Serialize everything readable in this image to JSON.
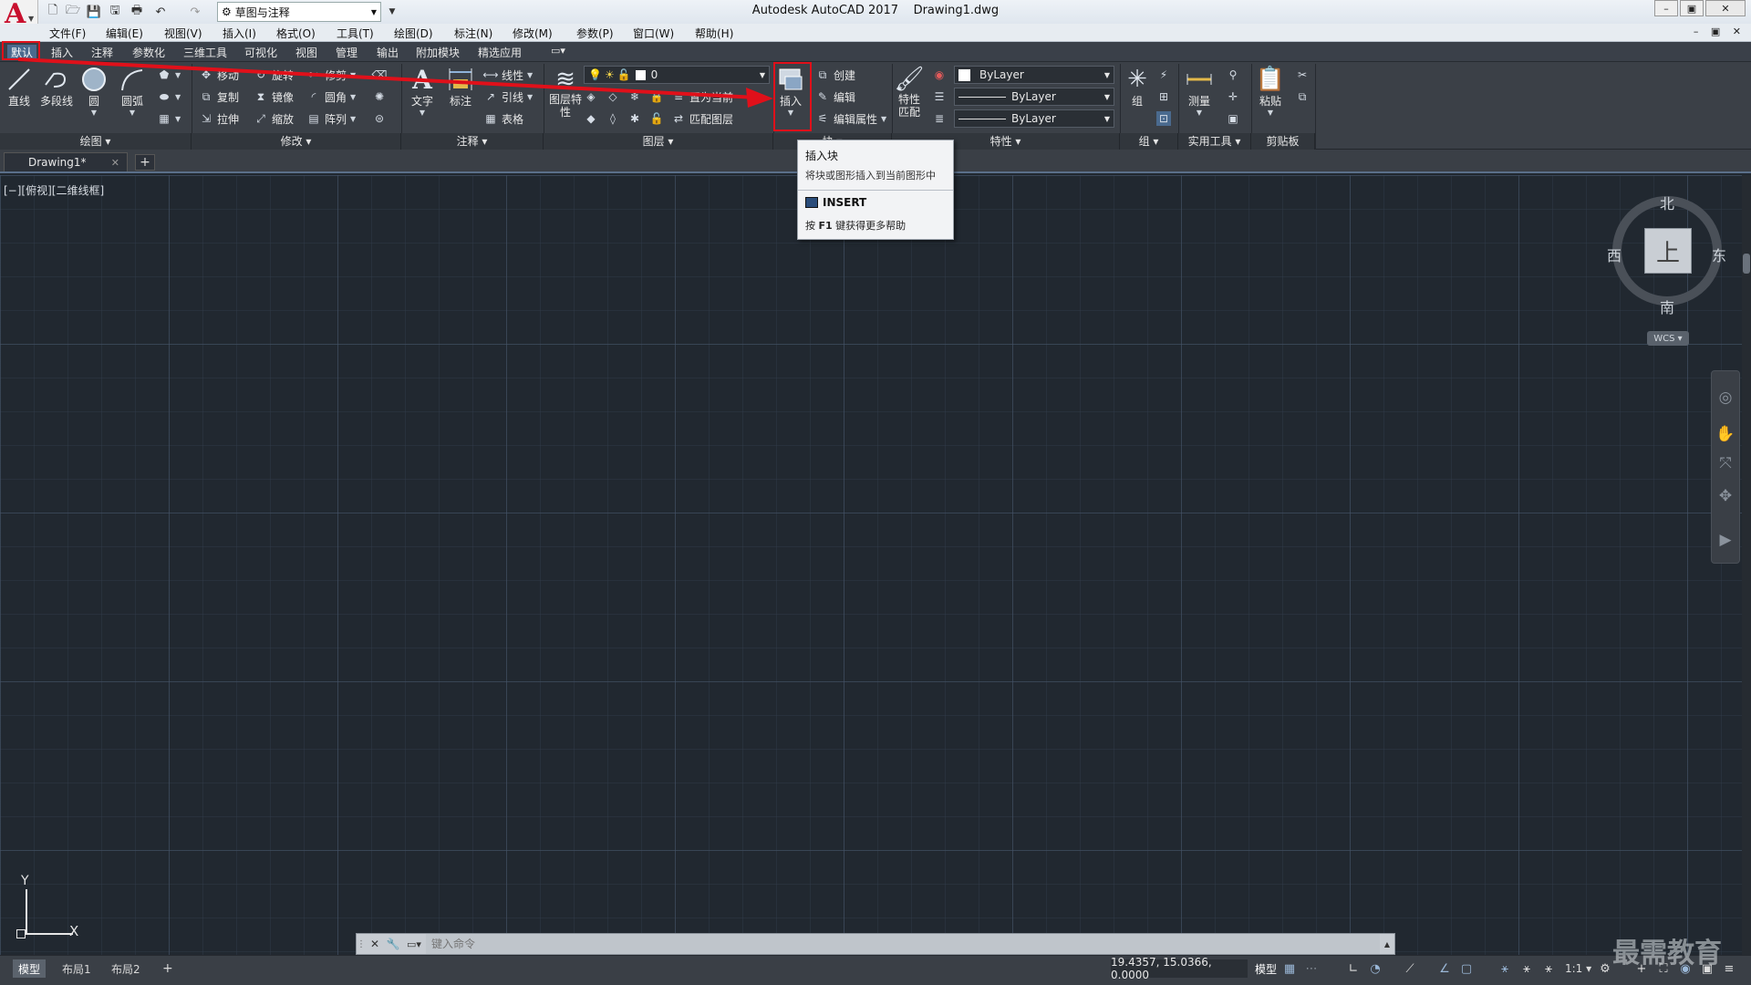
{
  "titlebar": {
    "app_title": "Autodesk AutoCAD 2017",
    "doc_title": "Drawing1.dwg",
    "workspace": "草图与注释",
    "win_min": "–",
    "win_restore": "▣",
    "win_close": "✕"
  },
  "menubar": {
    "items": [
      "文件(F)",
      "编辑(E)",
      "视图(V)",
      "插入(I)",
      "格式(O)",
      "工具(T)",
      "绘图(D)",
      "标注(N)",
      "修改(M)",
      "参数(P)",
      "窗口(W)",
      "帮助(H)"
    ],
    "mdi_controls": "– ▣ ✕"
  },
  "ribbon_tabs": [
    "默认",
    "插入",
    "注释",
    "参数化",
    "三维工具",
    "可视化",
    "视图",
    "管理",
    "输出",
    "附加模块",
    "精选应用"
  ],
  "ribbon": {
    "draw": {
      "title": "绘图",
      "line": "直线",
      "polyline": "多段线",
      "circle": "圆",
      "arc": "圆弧"
    },
    "modify": {
      "title": "修改",
      "move": "移动",
      "rotate": "旋转",
      "trim": "修剪",
      "copy": "复制",
      "mirror": "镜像",
      "fillet": "圆角",
      "stretch": "拉伸",
      "scale": "缩放",
      "array": "阵列"
    },
    "annotation": {
      "title": "注释",
      "text": "文字",
      "dimension": "标注",
      "linear": "线性",
      "leader": "引线",
      "table": "表格"
    },
    "layers": {
      "title": "图层",
      "layer_props": "图层特性",
      "current_layer": "0",
      "make_current": "置为当前",
      "match_layer": "匹配图层"
    },
    "block": {
      "title": "块",
      "insert": "插入",
      "create": "创建",
      "edit": "编辑",
      "edit_attr": "编辑属性"
    },
    "properties": {
      "title": "特性",
      "match": "特性匹配",
      "color": "ByLayer",
      "linetype": "ByLayer",
      "lineweight": "ByLayer"
    },
    "groups": {
      "title": "组",
      "group": "组"
    },
    "utilities": {
      "title": "实用工具",
      "measure": "测量"
    },
    "clipboard": {
      "title": "剪贴板",
      "paste": "粘贴"
    }
  },
  "doc_tabs": {
    "active": "Drawing1*",
    "close": "✕",
    "new": "+"
  },
  "viewport_label": "[−][俯视][二维线框]",
  "viewcube": {
    "north": "北",
    "south": "南",
    "east": "东",
    "west": "西",
    "face": "上",
    "wcs": "WCS"
  },
  "ucs": {
    "x": "X",
    "y": "Y"
  },
  "tooltip": {
    "title": "插入块",
    "description": "将块或图形插入到当前图形中",
    "command": "INSERT",
    "help_prefix": "按",
    "help_key": "F1",
    "help_suffix": "键获得更多帮助"
  },
  "command_line": {
    "placeholder": "键入命令"
  },
  "layout_tabs": [
    "模型",
    "布局1",
    "布局2"
  ],
  "statusbar": {
    "coords": "19.4357, 15.0366, 0.0000",
    "model": "模型",
    "scale": "1:1"
  },
  "watermark": "最需教育",
  "colors": {
    "annotation_red": "#e0101a",
    "accent_blue": "#4a6a8e"
  }
}
